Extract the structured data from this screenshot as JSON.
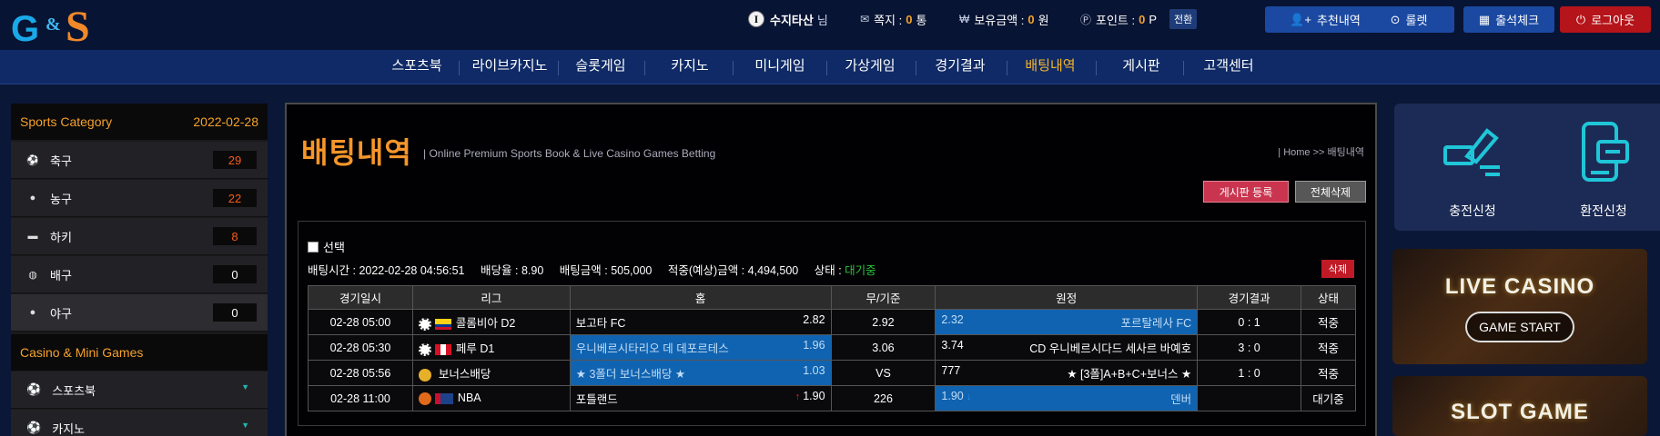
{
  "header": {
    "logo_text": "G&S",
    "user_name": "수지타산",
    "user_suffix": "님",
    "messages_label": "쪽지 :",
    "messages_count": "0",
    "messages_unit": "통",
    "balance_label": "보유금액 :",
    "balance_value": "0",
    "balance_unit": "원",
    "points_label": "포인트 :",
    "points_value": "0",
    "points_unit": "P",
    "switch_label": "전환",
    "buttons": {
      "referral": "추천내역",
      "roulette": "룰렛",
      "attendance": "출석체크",
      "logout": "로그아웃"
    }
  },
  "nav": [
    "스포츠북",
    "라이브카지노",
    "슬롯게임",
    "카지노",
    "미니게임",
    "가상게임",
    "경기결과",
    "배팅내역",
    "게시판",
    "고객센터"
  ],
  "nav_active": "배팅내역",
  "sidebar": {
    "sports_title": "Sports Category",
    "sports_date": "2022-02-28",
    "sports": [
      {
        "label": "축구",
        "count": "29"
      },
      {
        "label": "농구",
        "count": "22"
      },
      {
        "label": "하키",
        "count": "8"
      },
      {
        "label": "배구",
        "count": "0"
      },
      {
        "label": "야구",
        "count": "0"
      }
    ],
    "casino_title": "Casino & Mini Games",
    "casino": [
      {
        "label": "스포츠북"
      },
      {
        "label": "카지노"
      }
    ]
  },
  "main": {
    "title": "배팅내역",
    "subtitle": "| Online Premium Sports Book & Live Casino Games Betting",
    "breadcrumb": "| Home >> 배팅내역",
    "board_register": "게시판 등록",
    "delete_all": "전체삭제",
    "select_label": "선택",
    "bet_time_label": "배팅시간 :",
    "bet_time": "2022-02-28 04:56:51",
    "odds_label": "배당율 :",
    "odds": "8.90",
    "amount_label": "배팅금액 :",
    "amount": "505,000",
    "expected_label": "적중(예상)금액 :",
    "expected": "4,494,500",
    "status_label": "상태 :",
    "status": "대기중",
    "delete_label": "삭제",
    "table_headers": [
      "경기일시",
      "리그",
      "홈",
      "무/기준",
      "원정",
      "경기결과",
      "상태"
    ],
    "rows": [
      {
        "date": "02-28 05:00",
        "league": "콜롬비아 D2",
        "home": "보고타 FC",
        "home_odds": "2.82",
        "draw": "2.92",
        "away_odds": "2.32",
        "away": "포르탈레사 FC",
        "result": "0 : 1",
        "status": "적중"
      },
      {
        "date": "02-28 05:30",
        "league": "페루 D1",
        "home": "우니베르시타리오 데 데포르테스",
        "home_odds": "1.96",
        "draw": "3.06",
        "away_odds": "3.74",
        "away": "CD 우니베르시다드 세사르 바예호",
        "result": "3 : 0",
        "status": "적중"
      },
      {
        "date": "02-28 05:56",
        "league": "보너스배당",
        "home": "★ 3폴더 보너스배당 ★",
        "home_odds": "1.03",
        "draw": "VS",
        "away_odds": "777",
        "away": "★ [3폴]A+B+C+보너스 ★",
        "result": "1 : 0",
        "status": "적중"
      },
      {
        "date": "02-28 11:00",
        "league": "NBA",
        "home": "포틀랜드",
        "home_odds": "1.90",
        "draw": "226",
        "away_odds": "1.90",
        "away": "덴버",
        "result": "",
        "status": "대기중"
      }
    ]
  },
  "right": {
    "deposit": "충전신청",
    "withdraw": "환전신청",
    "live_casino": "LIVE CASINO",
    "game_start": "GAME START",
    "slot_game": "SLOT GAME"
  },
  "colors": {
    "accent_orange": "#f6962a",
    "highlight_blue": "#1063b0",
    "win_blue": "#2aa7e8",
    "nav_bg": "#0f2a66",
    "logout_red": "#b4141a"
  }
}
